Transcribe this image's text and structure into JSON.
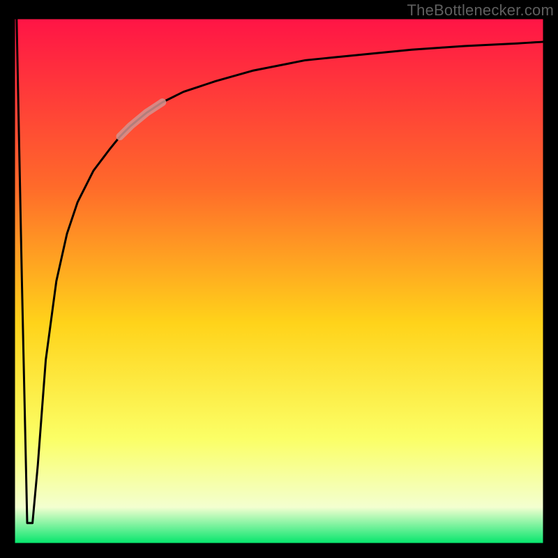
{
  "attribution": "TheBottleneсker.com",
  "colors": {
    "grad_top": "#ff1446",
    "grad_mid1": "#ff6a2a",
    "grad_mid2": "#ffd31a",
    "grad_mid3": "#fbff66",
    "grad_mid4": "#f3ffd0",
    "grad_bottom": "#00e56a",
    "frame": "#000000",
    "curve": "#000000",
    "highlight": "#d4938f"
  },
  "chart_data": {
    "type": "line",
    "title": "",
    "xlabel": "",
    "ylabel": "",
    "xlim": [
      0,
      100
    ],
    "ylim": [
      0,
      100
    ],
    "series": [
      {
        "name": "bottleneck-curve",
        "x": [
          0.5,
          1.5,
          2.5,
          3.5,
          4.5,
          6,
          8,
          10,
          12,
          15,
          18,
          20,
          22,
          25,
          28,
          32,
          38,
          45,
          55,
          65,
          75,
          85,
          95,
          100
        ],
        "values": [
          100,
          50,
          4,
          4,
          15,
          35,
          50,
          59,
          65,
          71,
          75,
          77.5,
          79.5,
          82,
          84,
          86,
          88,
          90,
          92,
          93,
          94,
          94.7,
          95.2,
          95.5
        ]
      }
    ],
    "highlight_segment": {
      "x_start": 20,
      "x_end": 28
    }
  }
}
